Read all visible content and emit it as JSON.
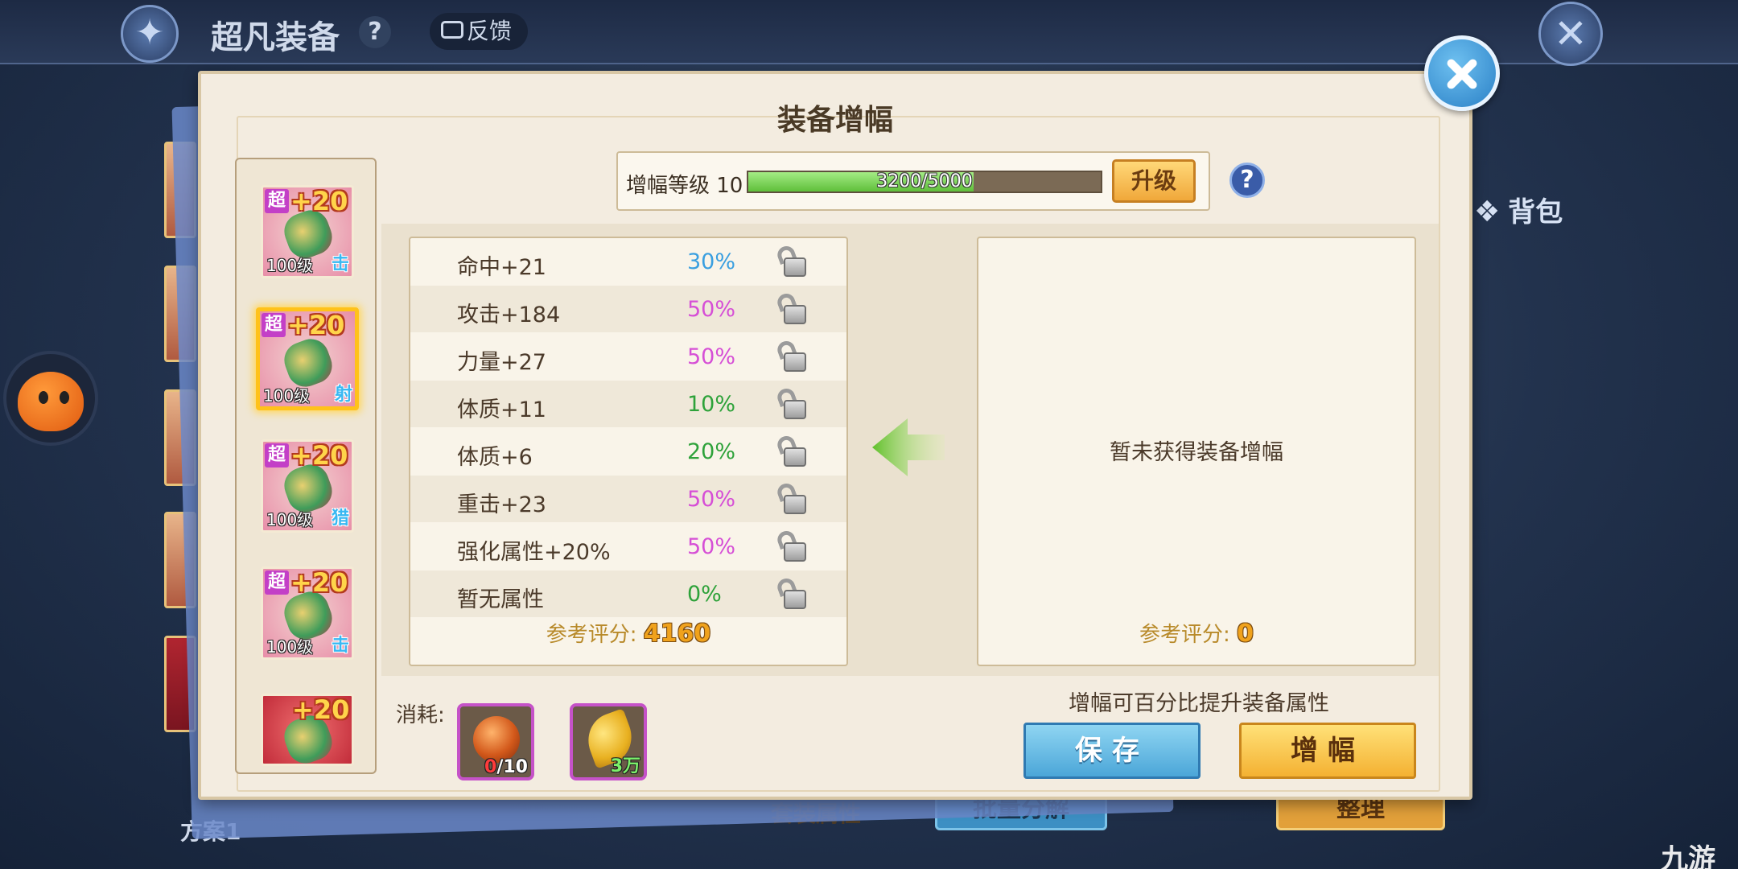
{
  "background": {
    "title": "超凡装备",
    "help": "?",
    "feedback": "反馈",
    "bag_label": "背包",
    "bottom_labels": [
      "方案1",
      "套装属性"
    ],
    "bottom_buttons": [
      "批量分解",
      "整理"
    ],
    "watermark": "九游"
  },
  "dialog": {
    "title": "装备增幅",
    "level_label": "增幅等级 10",
    "progress": {
      "current": 3200,
      "max": 5000,
      "text": "3200/5000"
    },
    "upgrade_button": "升级",
    "help_button": "?",
    "equipment": [
      {
        "badge": "超",
        "plus": "+20",
        "level": "100级",
        "class": "击",
        "selected": false
      },
      {
        "badge": "超",
        "plus": "+20",
        "level": "100级",
        "class": "射",
        "selected": true
      },
      {
        "badge": "超",
        "plus": "+20",
        "level": "100级",
        "class": "猎",
        "selected": false
      },
      {
        "badge": "超",
        "plus": "+20",
        "level": "100级",
        "class": "击",
        "selected": false
      },
      {
        "badge": "",
        "plus": "+20",
        "level": "",
        "class": "",
        "selected": false
      }
    ],
    "attributes": [
      {
        "name": "命中+21",
        "percent": "30%",
        "color": "#3a9fe0"
      },
      {
        "name": "攻击+184",
        "percent": "50%",
        "color": "#d64fd6"
      },
      {
        "name": "力量+27",
        "percent": "50%",
        "color": "#d64fd6"
      },
      {
        "name": "体质+11",
        "percent": "10%",
        "color": "#2ea23a"
      },
      {
        "name": "体质+6",
        "percent": "20%",
        "color": "#2ea23a"
      },
      {
        "name": "重击+23",
        "percent": "50%",
        "color": "#d64fd6"
      },
      {
        "name": "强化属性+20%",
        "percent": "50%",
        "color": "#d64fd6"
      },
      {
        "name": "暂无属性",
        "percent": "0%",
        "color": "#2ea23a"
      }
    ],
    "score_label": "参考评分:",
    "score_value": "4160",
    "result_empty": "暂未获得装备增幅",
    "result_score_label": "参考评分:",
    "result_score_value": "0",
    "consume_label": "消耗:",
    "items": [
      {
        "name": "gem",
        "have": "0",
        "need": "/10"
      },
      {
        "name": "gold-leaf",
        "count": "3万"
      }
    ],
    "tip": "增幅可百分比提升装备属性",
    "save_button": "保存",
    "amplify_button": "增幅"
  }
}
